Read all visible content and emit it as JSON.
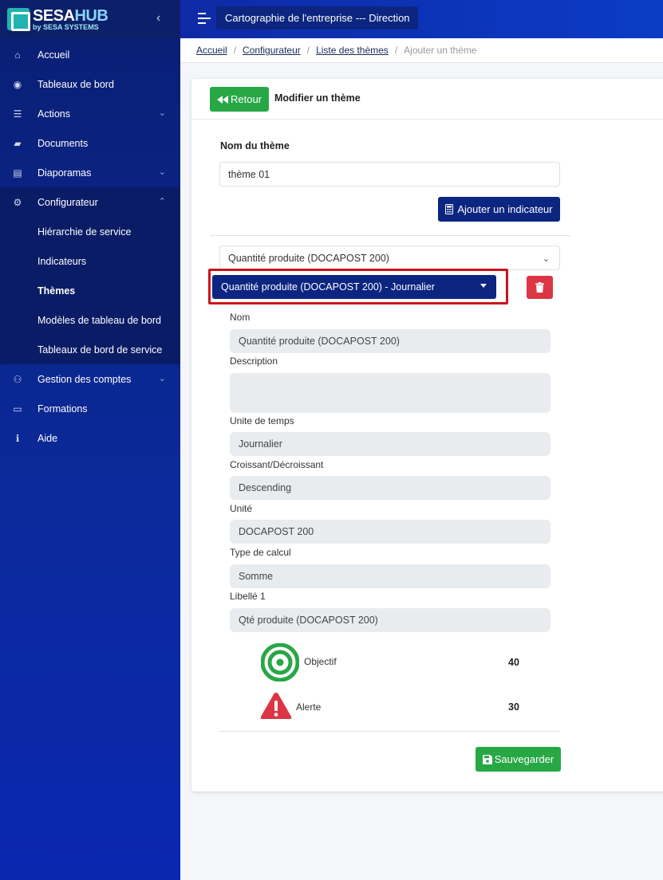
{
  "brand": {
    "name_part1": "SESA",
    "name_part2": "HUB",
    "subtitle": "by SESA SYSTEMS",
    "toggle": "‹"
  },
  "sidebar": {
    "items": [
      {
        "label": "Accueil",
        "icon": "home-icon",
        "glyph": "⌂"
      },
      {
        "label": "Tableaux de bord",
        "icon": "palette-icon",
        "glyph": "◉"
      },
      {
        "label": "Actions",
        "icon": "list-icon",
        "glyph": "☰",
        "chevron": "⌄"
      },
      {
        "label": "Documents",
        "icon": "folder-open-icon",
        "glyph": "▰"
      },
      {
        "label": "Diaporamas",
        "icon": "presentation-icon",
        "glyph": "▤",
        "chevron": "⌄"
      },
      {
        "label": "Configurateur",
        "icon": "cogs-icon",
        "glyph": "⚙",
        "chevron": "⌃"
      }
    ],
    "subitems": [
      {
        "label": "Hiérarchie de service"
      },
      {
        "label": "Indicateurs"
      },
      {
        "label": "Thèmes"
      },
      {
        "label": "Modèles de tableau de bord"
      },
      {
        "label": "Tableaux de bord de service"
      }
    ],
    "items_after": [
      {
        "label": "Gestion des comptes",
        "icon": "users-icon",
        "glyph": "⚇",
        "chevron": "⌄"
      },
      {
        "label": "Formations",
        "icon": "chalkboard-icon",
        "glyph": "▭"
      },
      {
        "label": "Aide",
        "icon": "info-circle-icon",
        "glyph": "ℹ"
      }
    ]
  },
  "topbar": {
    "title": "Cartographie de l'entreprise --- Direction"
  },
  "breadcrumb": {
    "items": [
      "Accueil",
      "Configurateur",
      "Liste des thèmes"
    ],
    "current": "Ajouter un thème",
    "separator": "/"
  },
  "card": {
    "back_label": "Retour",
    "title": "Modifier un thème",
    "theme_name_label": "Nom du thème",
    "theme_name_value": "thème 01",
    "add_indicator_label": "Ajouter un indicateur",
    "indicator_select_value": "Quantité produite (DOCAPOST 200)",
    "indicator_dropdown_value": "Quantité produite (DOCAPOST 200) - Journalier",
    "fields": [
      {
        "label": "Nom",
        "value": "Quantité produite (DOCAPOST 200)"
      },
      {
        "label": "Description",
        "value": ""
      },
      {
        "label": "Unite de temps",
        "value": "Journalier"
      },
      {
        "label": "Croissant/Décroissant",
        "value": "Descending"
      },
      {
        "label": "Unité",
        "value": "DOCAPOST 200"
      },
      {
        "label": "Type de calcul",
        "value": "Somme"
      },
      {
        "label": "Libellé 1",
        "value": "Qté produite (DOCAPOST 200)"
      }
    ],
    "objective": {
      "label": "Objectif",
      "value": "40"
    },
    "alert": {
      "label": "Alerte",
      "value": "30"
    },
    "save_label": "Sauvegarder"
  },
  "colors": {
    "accent_green": "#28a745",
    "navy": "#0b2580",
    "danger": "#dc3545",
    "highlight": "#c8151b"
  }
}
